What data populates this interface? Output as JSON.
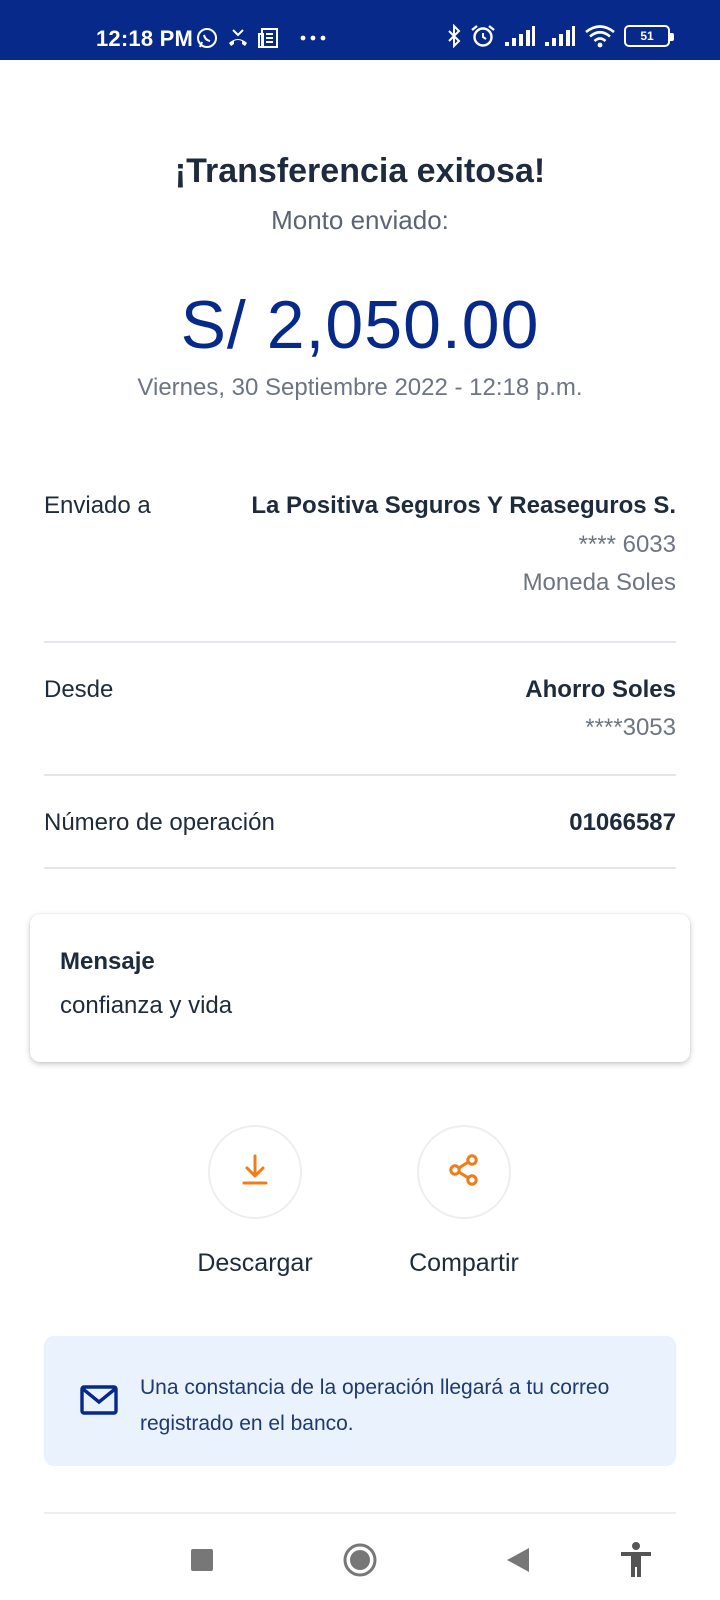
{
  "status_bar": {
    "time": "12:18 PM",
    "battery": "51",
    "icons_left": [
      "whatsapp-icon",
      "missed-call-icon",
      "news-icon",
      "more-icon"
    ],
    "icons_right": [
      "bluetooth-icon",
      "alarm-icon",
      "signal-icon",
      "signal-icon",
      "wifi-icon",
      "battery-icon"
    ]
  },
  "header": {
    "title": "¡Transferencia exitosa!",
    "subtitle": "Monto enviado:",
    "amount": "S/ 2,050.00",
    "date": "Viernes, 30 Septiembre 2022 - 12:18 p.m."
  },
  "details": {
    "sent_to_label": "Enviado a",
    "sent_to_name": "La Positiva Seguros Y Reaseguros S.",
    "sent_to_account": "**** 6033",
    "sent_to_currency": "Moneda Soles",
    "from_label": "Desde",
    "from_account_name": "Ahorro Soles",
    "from_account_number": "****3053",
    "operation_label": "Número de operación",
    "operation_number": "01066587"
  },
  "message": {
    "title": "Mensaje",
    "text": "confianza y vida"
  },
  "actions": {
    "download_label": "Descargar",
    "share_label": "Compartir",
    "icon_color": "#f07c1a"
  },
  "info": {
    "text": "Una constancia de la operación llegará a tu correo registrado en el banco."
  },
  "colors": {
    "status_bar": "#06298a",
    "amount": "#06298a",
    "accent": "#f07c1a",
    "info_bg": "#eaf2fd"
  },
  "nav": {
    "icons": [
      "recents-square-icon",
      "home-circle-icon",
      "back-triangle-icon",
      "accessibility-icon"
    ]
  }
}
